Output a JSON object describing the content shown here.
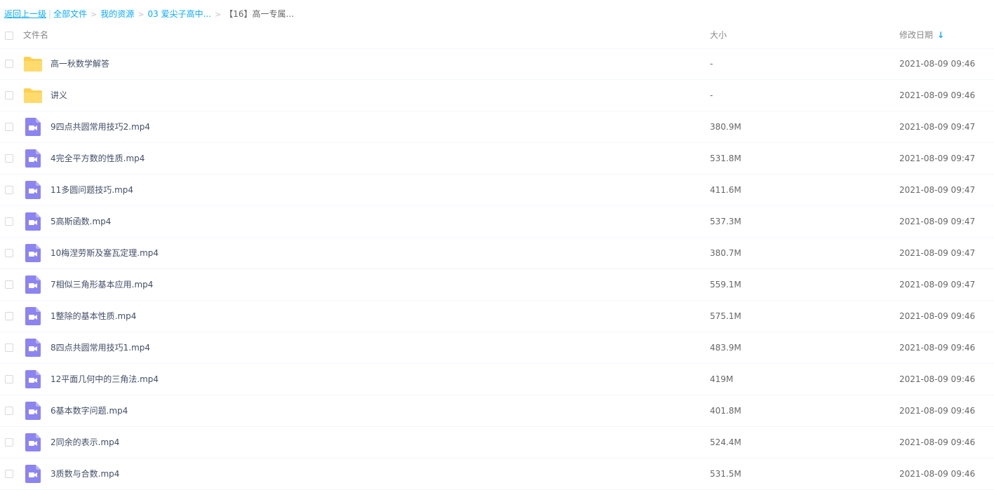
{
  "breadcrumb": {
    "back": "返回上一级",
    "items": [
      "全部文件",
      "我的资源",
      "03 爱尖子高中..."
    ],
    "current": "【16】高一专属...",
    "sep": ">"
  },
  "header": {
    "name": "文件名",
    "size": "大小",
    "date": "修改日期",
    "sort_arrow": "↓"
  },
  "colors": {
    "link": "#09aaff",
    "folder": "#ffd04f",
    "video": "#8c84f0"
  },
  "files": [
    {
      "name": "高一秋数学解答",
      "type": "folder",
      "size": "-",
      "date": "2021-08-09 09:46"
    },
    {
      "name": "讲义",
      "type": "folder",
      "size": "-",
      "date": "2021-08-09 09:46"
    },
    {
      "name": "9四点共圆常用技巧2.mp4",
      "type": "video",
      "size": "380.9M",
      "date": "2021-08-09 09:47"
    },
    {
      "name": "4完全平方数的性质.mp4",
      "type": "video",
      "size": "531.8M",
      "date": "2021-08-09 09:47"
    },
    {
      "name": "11多圆问题技巧.mp4",
      "type": "video",
      "size": "411.6M",
      "date": "2021-08-09 09:47"
    },
    {
      "name": "5高斯函数.mp4",
      "type": "video",
      "size": "537.3M",
      "date": "2021-08-09 09:47"
    },
    {
      "name": "10梅涅劳斯及塞瓦定理.mp4",
      "type": "video",
      "size": "380.7M",
      "date": "2021-08-09 09:47"
    },
    {
      "name": "7相似三角形基本应用.mp4",
      "type": "video",
      "size": "559.1M",
      "date": "2021-08-09 09:47"
    },
    {
      "name": "1整除的基本性质.mp4",
      "type": "video",
      "size": "575.1M",
      "date": "2021-08-09 09:46"
    },
    {
      "name": "8四点共圆常用技巧1.mp4",
      "type": "video",
      "size": "483.9M",
      "date": "2021-08-09 09:46"
    },
    {
      "name": "12平面几何中的三角法.mp4",
      "type": "video",
      "size": "419M",
      "date": "2021-08-09 09:46"
    },
    {
      "name": "6基本数字问题.mp4",
      "type": "video",
      "size": "401.8M",
      "date": "2021-08-09 09:46"
    },
    {
      "name": "2同余的表示.mp4",
      "type": "video",
      "size": "524.4M",
      "date": "2021-08-09 09:46"
    },
    {
      "name": "3质数与合数.mp4",
      "type": "video",
      "size": "531.5M",
      "date": "2021-08-09 09:46"
    }
  ]
}
